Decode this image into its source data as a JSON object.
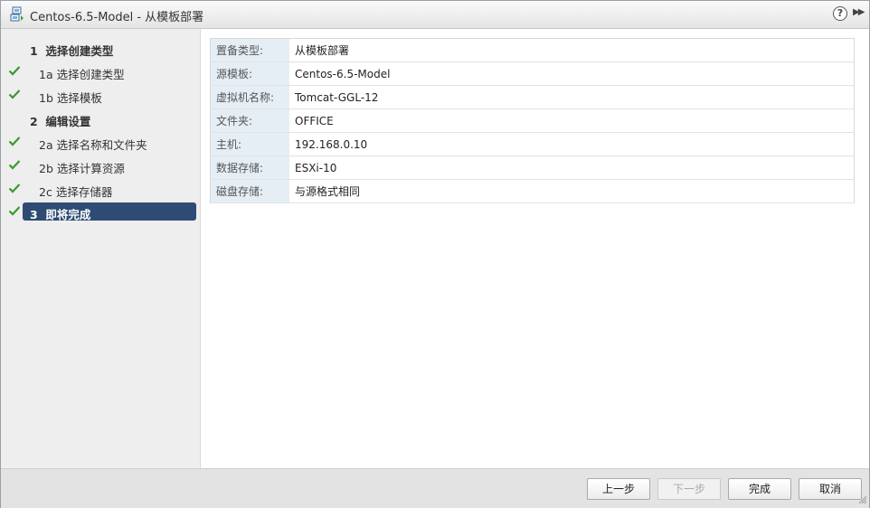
{
  "window": {
    "title": "Centos-6.5-Model - 从模板部署"
  },
  "steps": [
    {
      "num": "1",
      "label": "选择创建类型",
      "checked": false,
      "parent": true
    },
    {
      "num": "1a",
      "label": "选择创建类型",
      "checked": true
    },
    {
      "num": "1b",
      "label": "选择模板",
      "checked": true
    },
    {
      "num": "2",
      "label": "编辑设置",
      "checked": false,
      "parent": true
    },
    {
      "num": "2a",
      "label": "选择名称和文件夹",
      "checked": true
    },
    {
      "num": "2b",
      "label": "选择计算资源",
      "checked": true
    },
    {
      "num": "2c",
      "label": "选择存储器",
      "checked": true
    },
    {
      "num": "3",
      "label": "即将完成",
      "checked": true,
      "parent": true,
      "active": true
    }
  ],
  "review": [
    {
      "key": "置备类型:",
      "value": "从模板部署"
    },
    {
      "key": "源模板:",
      "value": "Centos-6.5-Model"
    },
    {
      "key": "虚拟机名称:",
      "value": "Tomcat-GGL-12"
    },
    {
      "key": "文件夹:",
      "value": "OFFICE"
    },
    {
      "key": "主机:",
      "value": "192.168.0.10"
    },
    {
      "key": "数据存储:",
      "value": "ESXi-10"
    },
    {
      "key": "磁盘存储:",
      "value": "与源格式相同"
    }
  ],
  "footer": {
    "back_label": "上一步",
    "next_label": "下一步",
    "finish_label": "完成",
    "cancel_label": "取消"
  },
  "colors": {
    "active_step": "#2e4c73",
    "check": "#3a9a2c",
    "key_cell": "#e6eef5"
  }
}
